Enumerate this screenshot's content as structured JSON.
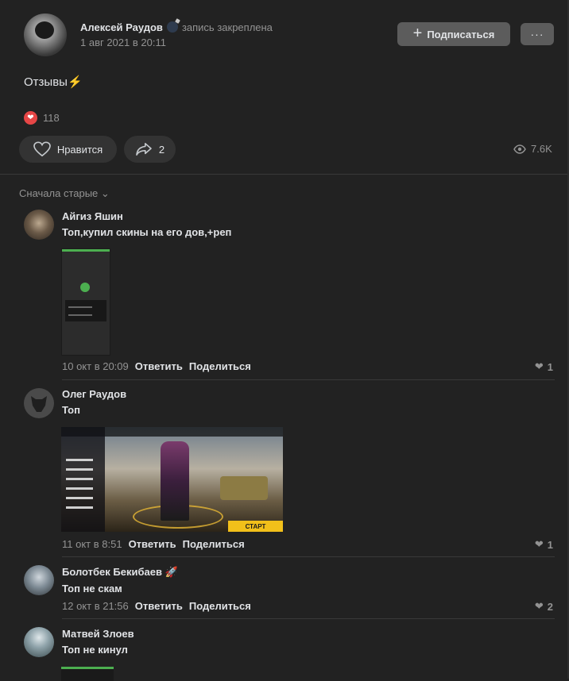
{
  "post": {
    "author": "Алексей Раудов",
    "pinned_label": "запись закреплена",
    "date": "1 авг 2021 в 20:11",
    "subscribe_label": "Подписаться",
    "more_label": "···",
    "text": "Отзывы",
    "likes_count": "118",
    "like_label": "Нравится",
    "shares_count": "2",
    "views": "7.6K"
  },
  "comments_sort": "Сначала старые",
  "comments": [
    {
      "name": "Айгиз Яшин",
      "text": "Топ,купил скины на его дов,+реп",
      "date": "10 окт в 20:09",
      "reply_label": "Ответить",
      "share_label": "Поделиться",
      "likes": "1"
    },
    {
      "name": "Олег Раудов",
      "text": "Топ",
      "date": "11 окт в 8:51",
      "reply_label": "Ответить",
      "share_label": "Поделиться",
      "likes": "1",
      "image_button": "СТАРТ"
    },
    {
      "name": "Болотбек Бекибаев",
      "text": "Топ не скам",
      "date": "12 окт в 21:56",
      "reply_label": "Ответить",
      "share_label": "Поделиться",
      "likes": "2"
    },
    {
      "name": "Матвей Злоев",
      "text": "Топ не кинул"
    }
  ],
  "colors": {
    "background": "#222222",
    "button": "#5c5c5c",
    "heart": "#e64646",
    "muted_text": "#939393"
  }
}
